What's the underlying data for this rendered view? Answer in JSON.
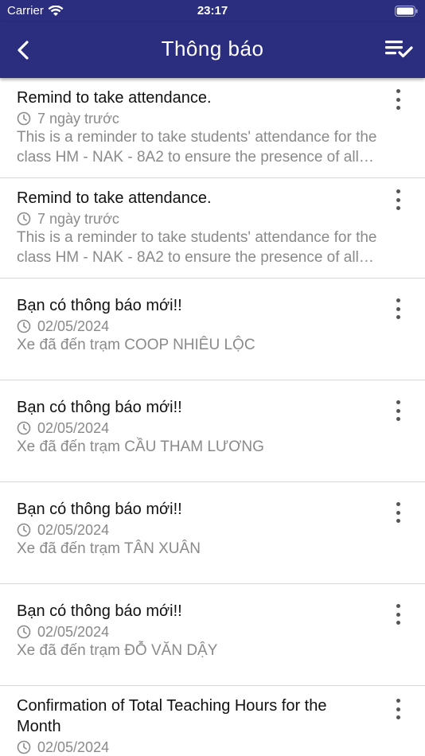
{
  "status_bar": {
    "carrier": "Carrier",
    "time": "23:17"
  },
  "header": {
    "title": "Thông báo",
    "back_icon": "chevron-left-icon",
    "action_icon": "mark-all-read-icon"
  },
  "colors": {
    "header_bg": "#2b2d7f",
    "title_text": "#111111",
    "secondary_text": "#8a8a8a",
    "divider": "#d6d6d6"
  },
  "notifications": [
    {
      "title": "Remind to take attendance.",
      "time": "7 ngày trước",
      "body": "This is a reminder to take students' attendance for the class HM - NAK - 8A2 to ensure the presence of all students."
    },
    {
      "title": "Remind to take attendance.",
      "time": "7 ngày trước",
      "body": "This is a reminder to take students' attendance for the class HM - NAK - 8A2 to ensure the presence of all students."
    },
    {
      "title": "Bạn có thông báo mới!!",
      "time": "02/05/2024",
      "body": "Xe đã đến trạm COOP NHIÊU LỘC"
    },
    {
      "title": "Bạn có thông báo mới!!",
      "time": "02/05/2024",
      "body": "Xe đã đến trạm CẦU THAM LƯƠNG"
    },
    {
      "title": "Bạn có thông báo mới!!",
      "time": "02/05/2024",
      "body": "Xe đã đến trạm TÂN XUÂN"
    },
    {
      "title": "Bạn có thông báo mới!!",
      "time": "02/05/2024",
      "body": "Xe đã đến trạm ĐỖ VĂN DẬY"
    },
    {
      "title": "Confirmation of Total Teaching Hours for the Month",
      "time": "02/05/2024",
      "body": ""
    }
  ]
}
